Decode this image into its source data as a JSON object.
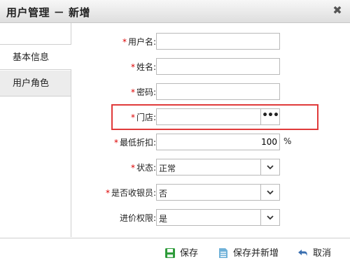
{
  "dialog": {
    "title": "用户管理 － 新增",
    "close_glyph": "✖"
  },
  "tabs": [
    {
      "label": "基本信息",
      "active": true
    },
    {
      "label": "用户角色",
      "active": false
    }
  ],
  "form": {
    "required_mark": "*",
    "username": {
      "label": "用户名:",
      "value": ""
    },
    "name": {
      "label": "姓名:",
      "value": ""
    },
    "password": {
      "label": "密码:",
      "value": ""
    },
    "store": {
      "label": "门店:",
      "value": "",
      "button": "•••"
    },
    "max_discount": {
      "label": "最低折扣:",
      "value": "100",
      "unit": "%"
    },
    "status": {
      "label": "状态:",
      "value": "正常"
    },
    "is_cashier": {
      "label": "是否收银员:",
      "value": "否"
    },
    "purchase_price_permission": {
      "label": "进价权限:",
      "value": "是"
    }
  },
  "footer": {
    "save": "保存",
    "save_and_new": "保存并新增",
    "cancel": "取消"
  },
  "colors": {
    "highlight": "#e03a3a",
    "required": "#dd0000",
    "save_icon": "#2e9b3a",
    "cancel_icon": "#3a6fb0"
  }
}
